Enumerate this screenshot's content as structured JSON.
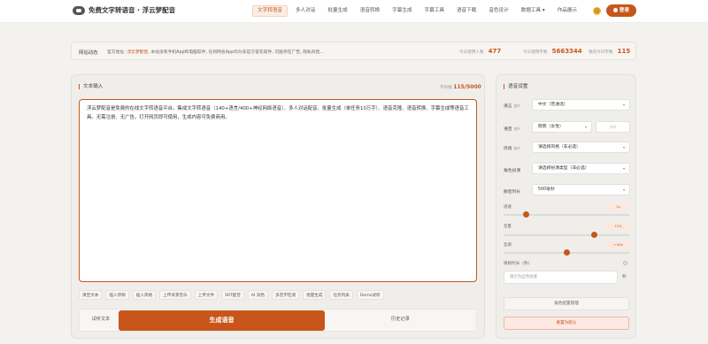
{
  "nav": {
    "title": "免费文字转语音 · 浮云梦配音",
    "items": [
      "文字转语音",
      "多人对话",
      "批量生成",
      "语音转换",
      "字幕生成",
      "字幕工具",
      "语音下载",
      "音色设计",
      "数据工具 ▾",
      "作品展示"
    ],
    "active_index": 0,
    "login": "登录"
  },
  "notice": {
    "label": "网站动态",
    "prefix": "官方地址: ",
    "link": "浮云梦配音",
    "text": ", 本站没有手机App和电脑软件, 任何网名App均为非官方冒充软件, 可能存在广告, 隐私风险...",
    "stats": [
      {
        "label": "今日使用人数",
        "value": "477"
      },
      {
        "label": "今日使用字数",
        "value": "5663344"
      },
      {
        "label": "我的今日字数",
        "value": "115"
      }
    ]
  },
  "editor": {
    "title": "文本输入",
    "count_label": "字符数",
    "count": "115/5000",
    "content": "浮云梦配音是免费的在线文字转语音平台。集成文字转语音（140+语言/400+神经网络语音）、多人对话配音、批量生成（单任务10万字）、语音克隆、语音转换、字幕生成等语音工具。无需注册、无广告，打开网页即可使用，生成内容可免费商用。"
  },
  "tools": [
    "清空文本",
    "插入停顿",
    "插入风格",
    "上传背景音乐",
    "上传文件",
    "SRT配音",
    "AI 润色",
    "多音字检测",
    "批量生成",
    "任务列表",
    "Demo试听"
  ],
  "actions": {
    "try": "试听文本",
    "generate": "生成语音",
    "history": "历史记录"
  },
  "settings": {
    "title": "语音设置",
    "language": {
      "label": "语言",
      "tag": "展开",
      "value": "中文（普通话）"
    },
    "voice": {
      "label": "语音",
      "tag": "展开",
      "value": "晓晓（女性）",
      "play": "试听"
    },
    "style": {
      "label": "风格",
      "tag": "展开",
      "value": "请选择风格（非必选）"
    },
    "role": {
      "label": "角色扮演",
      "value": "请选择扮演类型（非必选）"
    },
    "pause": {
      "label": "静音时长",
      "value": "500毫秒"
    },
    "speed": {
      "label": "语速",
      "value": "1x",
      "level": 0.18
    },
    "pitch": {
      "label": "音量",
      "value": "72%",
      "level": 0.72
    },
    "tone": {
      "label": "音调",
      "value": "+0Hz",
      "level": 0.5
    },
    "target_label": "目标时长（秒）",
    "target_placeholder": "留空为自然语速",
    "target_unit": "秒",
    "role_btn": "角色配置管理",
    "reset": "重置为默认"
  },
  "colors": {
    "accent": "#c8561a",
    "panel": "#f0eeeb"
  }
}
